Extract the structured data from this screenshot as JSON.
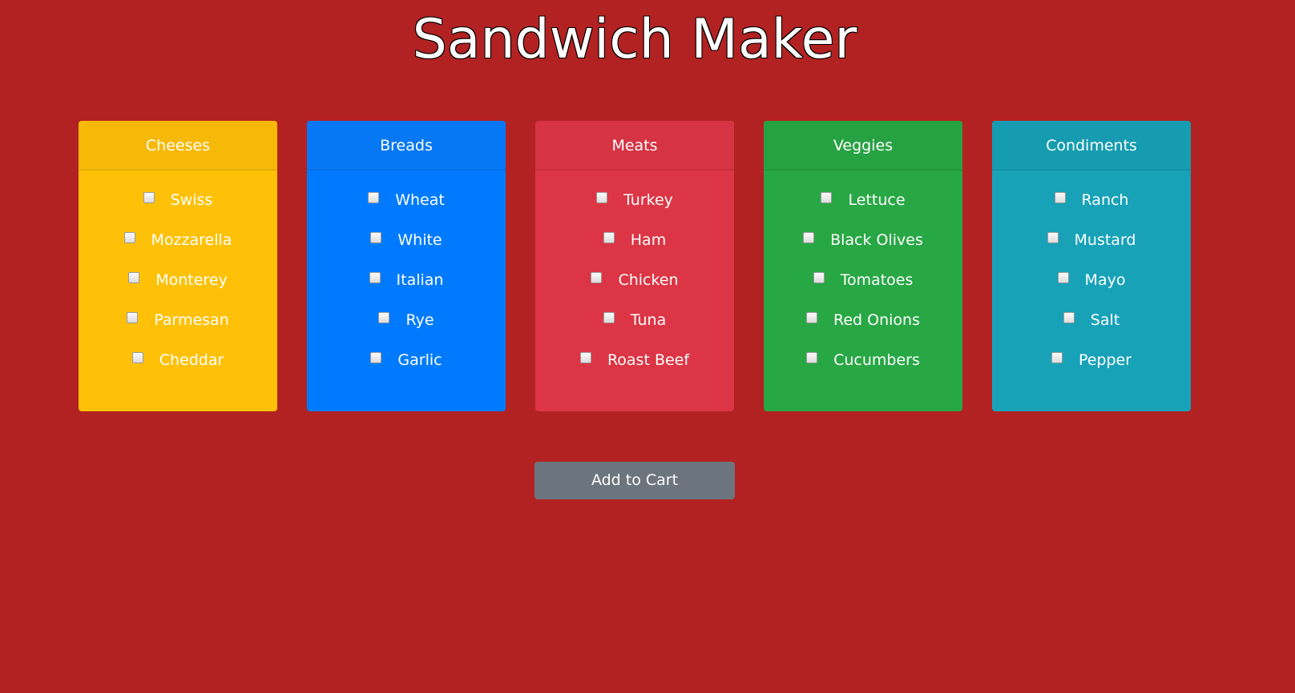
{
  "title": "Sandwich Maker",
  "colors": {
    "background": "#b22222",
    "cheeses": "#ffc107",
    "breads": "#007bff",
    "meats": "#dc3545",
    "veggies": "#28a745",
    "condiments": "#17a2b8",
    "cart_button": "#6c757d"
  },
  "categories": [
    {
      "name": "Cheeses",
      "items": [
        "Swiss",
        "Mozzarella",
        "Monterey",
        "Parmesan",
        "Cheddar"
      ]
    },
    {
      "name": "Breads",
      "items": [
        "Wheat",
        "White",
        "Italian",
        "Rye",
        "Garlic"
      ]
    },
    {
      "name": "Meats",
      "items": [
        "Turkey",
        "Ham",
        "Chicken",
        "Tuna",
        "Roast Beef"
      ]
    },
    {
      "name": "Veggies",
      "items": [
        "Lettuce",
        "Black Olives",
        "Tomatoes",
        "Red Onions",
        "Cucumbers"
      ]
    },
    {
      "name": "Condiments",
      "items": [
        "Ranch",
        "Mustard",
        "Mayo",
        "Salt",
        "Pepper"
      ]
    }
  ],
  "cart_button_label": "Add to Cart"
}
